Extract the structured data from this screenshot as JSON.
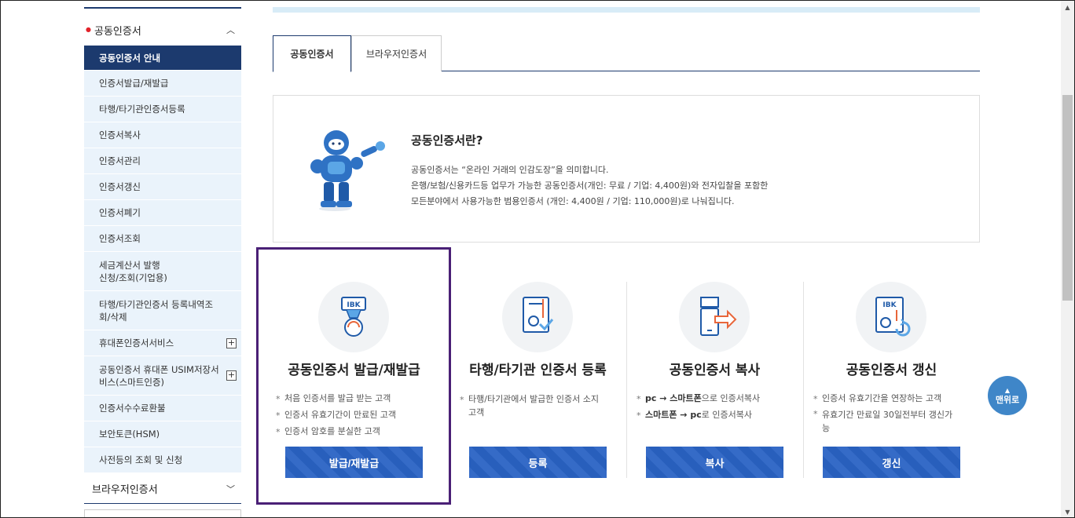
{
  "sidebar": {
    "section_title": "공동인증서",
    "items": [
      {
        "label": "공동인증서 안내",
        "active": true
      },
      {
        "label": "인증서발급/재발급"
      },
      {
        "label": "타행/타기관인증서등록"
      },
      {
        "label": "인증서복사"
      },
      {
        "label": "인증서관리"
      },
      {
        "label": "인증서갱신"
      },
      {
        "label": "인증서폐기"
      },
      {
        "label": "인증서조회"
      },
      {
        "label": "세금계산서 발행\n신청/조회(기업용)"
      },
      {
        "label": "타행/타기관인증서 등록내역조\n회/삭제"
      },
      {
        "label": "휴대폰인증서서비스",
        "expandable": true
      },
      {
        "label": "공동인증서 휴대폰 USIM저장서\n비스(스마트인증)",
        "expandable": true
      },
      {
        "label": "인증서수수료환불"
      },
      {
        "label": "보안토큰(HSM)"
      },
      {
        "label": "사전등의 조회 및 신청"
      }
    ],
    "footer_title": "브라우저인증서"
  },
  "tabs": [
    {
      "label": "공동인증서",
      "active": true
    },
    {
      "label": "브라우저인증서"
    }
  ],
  "info": {
    "title": "공동인증서란?",
    "lines": [
      "공동인증서는 “온라인 거래의 인감도장”을 의미합니다.",
      "은행/보험/신용카드등 업무가 가능한 공동인증서(개인: 무료 / 기업: 4,400원)와 전자입찰을 포함한",
      "모든분야에서 사용가능한 범용인증서 (개인: 4,400원 / 기업: 110,000원)로 나눠집니다."
    ]
  },
  "cards": [
    {
      "icon": "ibk-certificate-badge-icon",
      "title": "공동인증서 발급/재발급",
      "desc": [
        "처음 인증서를 발급 받는 고객",
        "인증서 유효기간이 만료된 고객",
        "인증서 암호를 분실한 고객"
      ],
      "button": "발급/재발급"
    },
    {
      "icon": "certificate-check-icon",
      "title": "타행/타기관 인증서 등록",
      "desc": [
        "타행/타기관에서 발급한 인증서 소지\n고객"
      ],
      "button": "등록"
    },
    {
      "icon": "phone-transfer-icon",
      "title": "공동인증서 복사",
      "desc_rich": [
        {
          "a": "pc → 스마트폰",
          "b": "으로 인증서복사"
        },
        {
          "a": "스마트폰 → pc",
          "b": "로 인증서복사"
        }
      ],
      "button": "복사"
    },
    {
      "icon": "ibk-certificate-renew-icon",
      "title": "공동인증서 갱신",
      "desc": [
        "인증서 유효기간을 연장하는 고객",
        "유효기간 만료일 30일전부터 갱신가\n능"
      ],
      "button": "갱신"
    }
  ],
  "to_top": {
    "label": "맨위로"
  },
  "colors": {
    "navy": "#1c3a6e",
    "button_blue": "#2a63c4",
    "highlight": "#4a2076",
    "sidebar_bg": "#eaf3fb",
    "to_top": "#3f86c8"
  }
}
